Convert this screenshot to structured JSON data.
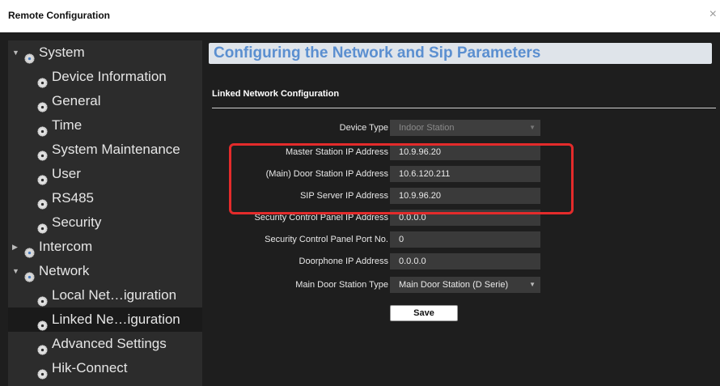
{
  "window": {
    "title": "Remote Configuration",
    "close_glyph": "×"
  },
  "sidebar": {
    "items": [
      {
        "label": "System",
        "level": 0,
        "expander": "▼",
        "icon": "gear-group-icon"
      },
      {
        "label": "Device Information",
        "level": 1,
        "icon": "gear-icon"
      },
      {
        "label": "General",
        "level": 1,
        "icon": "gear-icon"
      },
      {
        "label": "Time",
        "level": 1,
        "icon": "gear-icon"
      },
      {
        "label": "System Maintenance",
        "level": 1,
        "icon": "gear-icon"
      },
      {
        "label": "User",
        "level": 1,
        "icon": "gear-icon"
      },
      {
        "label": "RS485",
        "level": 1,
        "icon": "gear-icon"
      },
      {
        "label": "Security",
        "level": 1,
        "icon": "gear-icon"
      },
      {
        "label": "Intercom",
        "level": 0,
        "expander": "▶",
        "icon": "gear-group-icon"
      },
      {
        "label": "Network",
        "level": 0,
        "expander": "▼",
        "icon": "gear-group-icon"
      },
      {
        "label": "Local Net…iguration",
        "level": 1,
        "icon": "gear-icon"
      },
      {
        "label": "Linked Ne…iguration",
        "level": 1,
        "icon": "gear-icon",
        "selected": true
      },
      {
        "label": "Advanced Settings",
        "level": 1,
        "icon": "gear-icon"
      },
      {
        "label": "Hik-Connect",
        "level": 1,
        "icon": "gear-icon"
      }
    ]
  },
  "main": {
    "heading": "Configuring the Network and Sip Parameters",
    "section_title": "Linked Network Configuration",
    "fields": [
      {
        "key": "device-type",
        "label": "Device Type",
        "value": "Indoor Station",
        "kind": "select",
        "disabled": true
      },
      {
        "key": "master-station-ip",
        "label": "Master Station IP Address",
        "value": "10.9.96.20",
        "kind": "input"
      },
      {
        "key": "main-door-station-ip",
        "label": "(Main) Door Station IP Address",
        "value": "10.6.120.211",
        "kind": "input"
      },
      {
        "key": "sip-server-ip",
        "label": "SIP Server IP Address",
        "value": "10.9.96.20",
        "kind": "input"
      },
      {
        "key": "security-panel-ip",
        "label": "Security Control Panel IP Address",
        "value": "0.0.0.0",
        "kind": "input"
      },
      {
        "key": "security-panel-port",
        "label": "Security Control Panel Port No.",
        "value": "0",
        "kind": "input"
      },
      {
        "key": "doorphone-ip",
        "label": "Doorphone IP Address",
        "value": "0.0.0.0",
        "kind": "input"
      },
      {
        "key": "main-door-station-type",
        "label": "Main Door Station Type",
        "value": "Main Door Station (D Serie)",
        "kind": "select"
      }
    ],
    "save_label": "Save",
    "dropdown_glyph": "▼"
  },
  "colors": {
    "highlight": "#e42b2b",
    "heading": "#5b8fd0",
    "banner": "#dfe4ea"
  }
}
